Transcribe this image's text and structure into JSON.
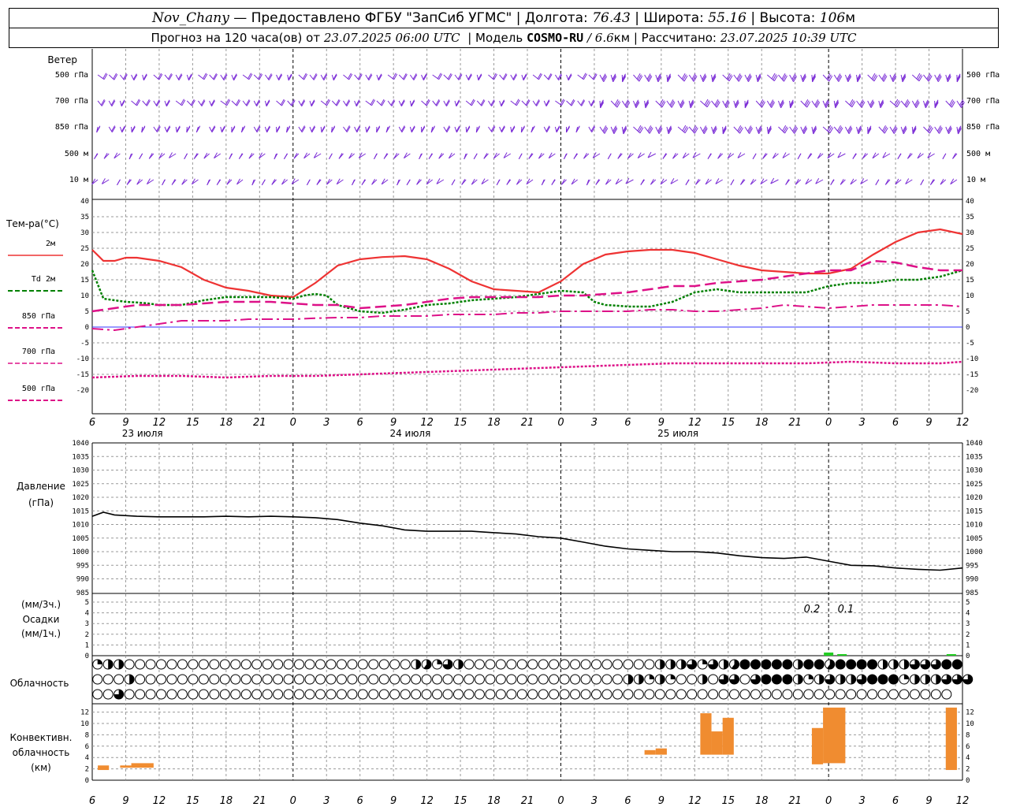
{
  "header": {
    "station": "Nov_Chany",
    "provider": "— Предоставлено ФГБУ \"ЗапСиб УГМС\" |",
    "lon_label": "Долгота:",
    "lon_value": "76.43",
    "lat_label": "| Широта:",
    "lat_value": "55.16",
    "alt_label": "| Высота:",
    "alt_value": "106",
    "alt_unit": "м",
    "forecast_label": "Прогноз на 120 часа(ов) от",
    "forecast_start": "23.07.2025 06:00 UTC",
    "model_label": "| Модель",
    "model_name": "COSMO-RU",
    "model_res": "/ 6.6",
    "model_res_unit": "км",
    "calc_label": "| Рассчитано:",
    "calc_time": "23.07.2025 10:39 UTC"
  },
  "wind_panel": {
    "title": "Ветер",
    "levels": [
      "500 гПа",
      "700 гПа",
      "850 гПа",
      "500 м",
      "10 м"
    ]
  },
  "temp_panel": {
    "title": "Тем-ра(°C)",
    "legend": [
      {
        "label": "2м",
        "color": "#ee3333",
        "style": "solid"
      },
      {
        "label": "Td 2м",
        "color": "#008000",
        "style": "dotted"
      },
      {
        "label": "850 гПа",
        "color": "#dd1188",
        "style": "dashed"
      },
      {
        "label": "700 гПа",
        "color": "#dd1188",
        "style": "dashdot"
      },
      {
        "label": "500 гПа",
        "color": "#dd1188",
        "style": "dotted"
      }
    ]
  },
  "pressure_panel": {
    "title": "Давление",
    "unit": "(гПа)"
  },
  "precip_panel": {
    "unit_3h": "(мм/3ч.)",
    "title": "Осадки",
    "unit_1h": "(мм/1ч.)",
    "annotations": [
      "0.2",
      "0.1"
    ]
  },
  "cloud_panel": {
    "title": "Облачность"
  },
  "conv_panel": {
    "title_lines": [
      "Конвективн.",
      "облачность",
      "(км)"
    ]
  },
  "date_labels": [
    "23 июля",
    "24 июля",
    "25 июля"
  ],
  "chart_data": {
    "type": "line",
    "x_hour_labels": [
      "6",
      "9",
      "12",
      "15",
      "18",
      "21",
      "0",
      "3",
      "6",
      "9",
      "12",
      "15",
      "18",
      "21",
      "0",
      "3",
      "6",
      "9",
      "12",
      "15",
      "18",
      "21",
      "0",
      "3",
      "6",
      "9",
      "12"
    ],
    "x_hours": [
      0,
      78
    ],
    "temperature": {
      "ylim": [
        -20,
        40
      ],
      "ticks": [
        -20,
        -15,
        -10,
        -5,
        0,
        5,
        10,
        15,
        20,
        25,
        30,
        35,
        40
      ],
      "series": [
        {
          "name": "2м",
          "x": [
            0,
            1,
            2,
            3,
            4,
            6,
            8,
            10,
            12,
            14,
            16,
            18,
            20,
            22,
            24,
            26,
            28,
            30,
            32,
            34,
            36,
            38,
            40,
            42,
            44,
            46,
            48,
            50,
            52,
            54,
            56,
            58,
            60,
            62,
            64,
            66,
            68,
            70,
            72,
            74,
            76,
            78
          ],
          "values": [
            24.5,
            21,
            21,
            22,
            22,
            21,
            19,
            15,
            12.5,
            11.5,
            10,
            9.5,
            14,
            19.5,
            21.5,
            22.2,
            22.5,
            21.5,
            18.5,
            14.5,
            12,
            11.5,
            11,
            14.5,
            20,
            23,
            24,
            24.5,
            24.5,
            23.5,
            21.5,
            19.5,
            18,
            17.5,
            17,
            17,
            18.5,
            23,
            27,
            30,
            31,
            29.5
          ]
        },
        {
          "name": "Td 2м",
          "x": [
            0,
            1,
            2,
            3,
            4,
            5,
            6,
            7,
            8,
            10,
            12,
            14,
            16,
            18,
            19,
            20,
            21,
            22,
            24,
            26,
            28,
            30,
            32,
            34,
            36,
            38,
            40,
            42,
            44,
            45,
            46,
            47,
            48,
            50,
            52,
            54,
            56,
            58,
            60,
            62,
            64,
            66,
            68,
            70,
            72,
            74,
            76,
            78
          ],
          "values": [
            18,
            9,
            8.5,
            8,
            7.8,
            7.5,
            7,
            7,
            7,
            8.5,
            9.5,
            9.5,
            9.5,
            9,
            10,
            10.5,
            10,
            7,
            5,
            4.5,
            5.5,
            7,
            7.5,
            8.5,
            9,
            9.5,
            10.5,
            11.5,
            11,
            8,
            7,
            6.8,
            6.5,
            6.5,
            8,
            11,
            12,
            11,
            11,
            11,
            11,
            13,
            14,
            14,
            15,
            15,
            16,
            18
          ]
        },
        {
          "name": "850 гПа",
          "x": [
            0,
            2,
            4,
            6,
            8,
            10,
            12,
            14,
            16,
            18,
            20,
            22,
            24,
            26,
            28,
            30,
            32,
            34,
            36,
            38,
            40,
            42,
            44,
            46,
            48,
            50,
            52,
            54,
            56,
            58,
            60,
            62,
            64,
            66,
            68,
            70,
            72,
            74,
            76,
            78
          ],
          "values": [
            5,
            6,
            7,
            7,
            7,
            7.5,
            8,
            8,
            8,
            7.5,
            7,
            7,
            6,
            6.5,
            7,
            8,
            9,
            9.5,
            9.5,
            9.5,
            9.5,
            10,
            10,
            10.5,
            11,
            12,
            13,
            13,
            14,
            14.5,
            15,
            16,
            17,
            18,
            18,
            21,
            20.5,
            19,
            18,
            18
          ]
        },
        {
          "name": "700 гПа",
          "x": [
            0,
            2,
            4,
            6,
            8,
            10,
            12,
            14,
            16,
            18,
            20,
            22,
            24,
            26,
            28,
            30,
            32,
            34,
            36,
            38,
            40,
            42,
            44,
            46,
            48,
            50,
            52,
            54,
            56,
            58,
            60,
            62,
            64,
            66,
            68,
            70,
            72,
            74,
            76,
            78
          ],
          "values": [
            -0.5,
            -1,
            0,
            1,
            2,
            2,
            2,
            2.5,
            2.5,
            2.5,
            2.8,
            3,
            3,
            3.5,
            3.5,
            3.5,
            4,
            4,
            4,
            4.5,
            4.5,
            5,
            5,
            5,
            5,
            5.5,
            5.5,
            5,
            5,
            5.5,
            6,
            7,
            6.5,
            6,
            6.5,
            7,
            7,
            7,
            7,
            6.5
          ]
        },
        {
          "name": "500 гПа",
          "x": [
            0,
            4,
            8,
            12,
            16,
            20,
            24,
            28,
            32,
            36,
            40,
            44,
            48,
            52,
            56,
            60,
            64,
            68,
            72,
            76,
            78
          ],
          "values": [
            -16,
            -15.5,
            -15.5,
            -16,
            -15.5,
            -15.5,
            -15,
            -14.5,
            -14,
            -13.5,
            -13,
            -12.5,
            -12,
            -11.5,
            -11.5,
            -11.5,
            -11.5,
            -11,
            -11.5,
            -11.5,
            -11
          ]
        }
      ]
    },
    "pressure": {
      "ylim": [
        985,
        1040
      ],
      "ticks": [
        985,
        990,
        995,
        1000,
        1005,
        1010,
        1015,
        1020,
        1025,
        1030,
        1035,
        1040
      ],
      "x": [
        0,
        1,
        2,
        4,
        6,
        8,
        10,
        12,
        14,
        16,
        18,
        20,
        22,
        24,
        26,
        28,
        30,
        32,
        34,
        36,
        38,
        40,
        42,
        44,
        46,
        48,
        50,
        52,
        54,
        56,
        58,
        60,
        62,
        64,
        66,
        68,
        70,
        72,
        74,
        76,
        78
      ],
      "values": [
        1013,
        1014.5,
        1013.5,
        1013,
        1012.8,
        1012.8,
        1012.8,
        1013,
        1012.8,
        1013,
        1012.8,
        1012.5,
        1011.8,
        1010.5,
        1009.5,
        1008,
        1007.5,
        1007.5,
        1007.5,
        1007,
        1006.5,
        1005.5,
        1005,
        1003.5,
        1002,
        1001,
        1000.5,
        1000,
        1000,
        999.5,
        998.5,
        997.8,
        997.5,
        998,
        996.5,
        995,
        994.8,
        994,
        993.5,
        993.2,
        994
      ]
    },
    "precipitation": {
      "ylim": [
        0,
        5
      ],
      "ticks": [
        0,
        1,
        2,
        3,
        4,
        5
      ],
      "bars": [
        {
          "x": 66,
          "value": 0.2
        },
        {
          "x": 67.2,
          "value": 0.1
        },
        {
          "x": 77,
          "value": 0.1
        }
      ]
    },
    "cloud_cover": {
      "rows": 3,
      "description": "Okta-style fraction per hour for three layers (0=clear, 1=overcast)",
      "high": [
        0.25,
        0.5,
        0.5,
        0,
        0,
        0,
        0,
        0,
        0,
        0,
        0,
        0,
        0,
        0,
        0,
        0,
        0,
        0,
        0,
        0,
        0,
        0,
        0,
        0,
        0,
        0,
        0,
        0,
        0,
        0,
        0.5,
        0.6,
        0.25,
        0.75,
        0.5,
        0,
        0,
        0,
        0,
        0,
        0,
        0,
        0,
        0,
        0,
        0,
        0,
        0,
        0,
        0,
        0,
        0,
        0,
        0.5,
        0.5,
        0.5,
        0.75,
        0.25,
        0.75,
        0.5,
        0.6,
        1,
        1,
        1,
        1,
        1,
        0.5,
        1,
        1,
        0.6,
        1,
        1,
        1,
        1,
        0.5,
        0.5,
        0.5,
        0.75,
        0.75,
        0.75,
        1,
        1
      ],
      "mid": [
        0,
        0,
        0,
        0.5,
        0,
        0,
        0,
        0,
        0,
        0,
        0,
        0,
        0,
        0,
        0,
        0,
        0,
        0,
        0,
        0,
        0,
        0,
        0,
        0,
        0,
        0,
        0,
        0,
        0,
        0,
        0,
        0,
        0,
        0,
        0,
        0,
        0,
        0,
        0,
        0,
        0,
        0,
        0,
        0,
        0,
        0,
        0,
        0,
        0,
        0,
        0.5,
        0.5,
        0.25,
        0.5,
        0.25,
        0,
        0,
        0.5,
        0,
        0.75,
        0.75,
        0,
        0.75,
        1,
        1,
        1,
        0.5,
        0.25,
        0.5,
        0.75,
        0.5,
        0.5,
        0.75,
        1,
        1,
        1,
        0.25,
        0.5,
        0.5,
        0.5,
        0.75,
        0.75,
        0.75
      ],
      "low": [
        0,
        0,
        0.75,
        0,
        0,
        0,
        0,
        0,
        0,
        0,
        0,
        0,
        0,
        0,
        0,
        0,
        0,
        0,
        0,
        0,
        0,
        0,
        0,
        0,
        0,
        0,
        0,
        0,
        0,
        0,
        0,
        0,
        0,
        0,
        0,
        0,
        0,
        0,
        0,
        0,
        0,
        0,
        0,
        0,
        0,
        0,
        0,
        0,
        0,
        0,
        0,
        0,
        0,
        0,
        0,
        0,
        0,
        0,
        0,
        0,
        0,
        0,
        0,
        0,
        0,
        0,
        0,
        0,
        0,
        0,
        0,
        0,
        0,
        0,
        0,
        0,
        0,
        0,
        0,
        0,
        0
      ]
    },
    "convective": {
      "ylim": [
        0,
        13
      ],
      "ticks": [
        0,
        2,
        4,
        6,
        8,
        10,
        12
      ],
      "bars": [
        {
          "x0": 0.5,
          "x1": 1.5,
          "bottom": 1.8,
          "top": 2.6
        },
        {
          "x0": 2.5,
          "x1": 3.5,
          "bottom": 2.2,
          "top": 2.6
        },
        {
          "x0": 3.5,
          "x1": 5.5,
          "bottom": 2.2,
          "top": 3.0
        },
        {
          "x0": 49.5,
          "x1": 50.5,
          "bottom": 4.5,
          "top": 5.3
        },
        {
          "x0": 50.5,
          "x1": 51.5,
          "bottom": 4.5,
          "top": 5.6
        },
        {
          "x0": 54.5,
          "x1": 55.5,
          "bottom": 4.5,
          "top": 11.8
        },
        {
          "x0": 55.5,
          "x1": 56.5,
          "bottom": 4.5,
          "top": 8.6
        },
        {
          "x0": 56.5,
          "x1": 57.5,
          "bottom": 4.5,
          "top": 11.0
        },
        {
          "x0": 64.5,
          "x1": 65.5,
          "bottom": 2.8,
          "top": 9.2
        },
        {
          "x0": 65.5,
          "x1": 67.5,
          "bottom": 3.0,
          "top": 12.8
        },
        {
          "x0": 76.5,
          "x1": 77.5,
          "bottom": 1.8,
          "top": 12.8
        }
      ]
    },
    "wind_barbs": {
      "levels": [
        "500 гПа",
        "700 гПа",
        "850 гПа",
        "500 м",
        "10 м"
      ]
    }
  }
}
